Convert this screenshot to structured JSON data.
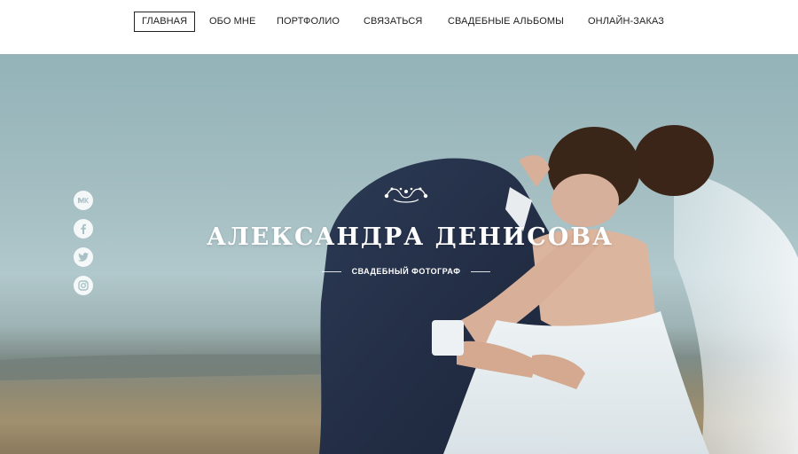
{
  "nav": {
    "items": [
      {
        "label": "ГЛАВНАЯ",
        "active": true
      },
      {
        "label": "ОБО МНЕ",
        "active": false
      },
      {
        "label": "ПОРТФОЛИО",
        "active": false
      },
      {
        "label": "СВЯЗАТЬСЯ",
        "active": false
      },
      {
        "label": "СВАДЕБНЫЕ АЛЬБОМЫ",
        "active": false
      },
      {
        "label": "ОНЛАЙН-ЗАКАЗ",
        "active": false
      }
    ]
  },
  "hero": {
    "title": "АЛЕКСАНДРА ДЕНИСОВА",
    "subtitle": "СВАДЕБНЫЙ ФОТОГРАФ",
    "image": "wedding-couple-embrace-photo"
  },
  "social": [
    {
      "icon": "vk-icon"
    },
    {
      "icon": "facebook-icon"
    },
    {
      "icon": "twitter-icon"
    },
    {
      "icon": "instagram-icon"
    }
  ],
  "colors": {
    "nav_text": "#222222",
    "hero_text": "#ffffff",
    "sky": "#a4bec2"
  }
}
